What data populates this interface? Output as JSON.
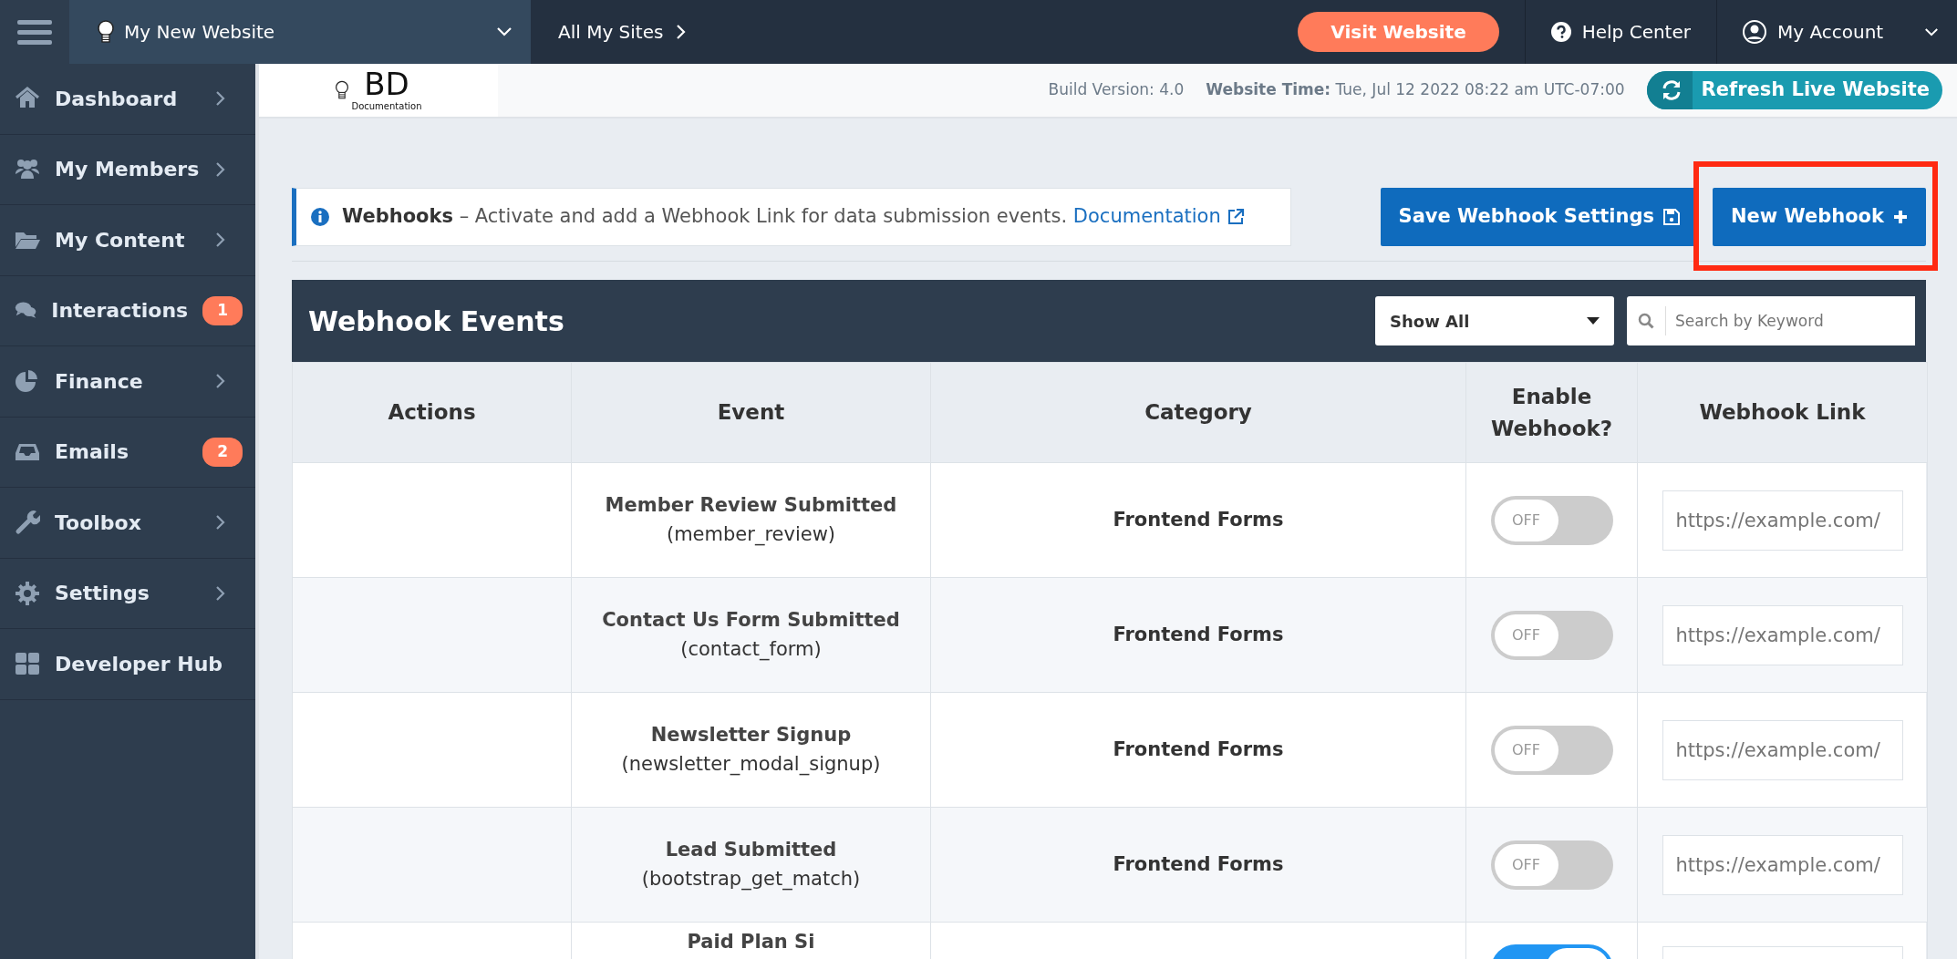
{
  "topbar": {
    "site_name": "My New Website",
    "all_sites": "All My Sites",
    "visit_button": "Visit Website",
    "help": "Help Center",
    "account": "My Account"
  },
  "subheader": {
    "logo_mark": "BD",
    "logo_caption": "Documentation",
    "build_version": "Build Version: 4.0",
    "time_label": "Website Time:",
    "time_value": "Tue, Jul 12 2022 08:22 am UTC-07:00",
    "refresh_button": "Refresh Live Website"
  },
  "sidebar": {
    "items": [
      {
        "label": "Dashboard",
        "has_submenu": true
      },
      {
        "label": "My Members",
        "has_submenu": true
      },
      {
        "label": "My Content",
        "has_submenu": true
      },
      {
        "label": "Interactions",
        "has_submenu": false,
        "badge": "1"
      },
      {
        "label": "Finance",
        "has_submenu": true
      },
      {
        "label": "Emails",
        "has_submenu": false,
        "badge": "2"
      },
      {
        "label": "Toolbox",
        "has_submenu": true
      },
      {
        "label": "Settings",
        "has_submenu": true
      },
      {
        "label": "Developer Hub",
        "has_submenu": false
      }
    ]
  },
  "notice": {
    "title": "Webhooks",
    "text": "– Activate and add a Webhook Link for data submission events.",
    "link": "Documentation"
  },
  "buttons": {
    "save": "Save Webhook Settings",
    "new": "New Webhook",
    "new_highlighted": true
  },
  "table": {
    "title": "Webhook Events",
    "filter": "Show All",
    "search": {
      "placeholder": "Search by Keyword"
    },
    "columns": [
      "Actions",
      "Event",
      "Category",
      "Enable Webhook?",
      "Webhook Link"
    ],
    "rows": [
      {
        "event": "Member Review Submitted",
        "code": "(member_review)",
        "category": "Frontend Forms",
        "on": false,
        "toggle_label": "OFF",
        "link_placeholder": "https://example.com/"
      },
      {
        "event": "Contact Us Form Submitted",
        "code": "(contact_form)",
        "category": "Frontend Forms",
        "on": false,
        "toggle_label": "OFF",
        "link_placeholder": "https://example.com/"
      },
      {
        "event": "Newsletter Signup",
        "code": "(newsletter_modal_signup)",
        "category": "Frontend Forms",
        "on": false,
        "toggle_label": "OFF",
        "link_placeholder": "https://example.com/"
      },
      {
        "event": "Lead Submitted",
        "code": "(bootstrap_get_match)",
        "category": "Frontend Forms",
        "on": false,
        "toggle_label": "OFF",
        "link_placeholder": "https://example.com/"
      },
      {
        "event": "Paid Plan Si",
        "on": true
      }
    ]
  }
}
